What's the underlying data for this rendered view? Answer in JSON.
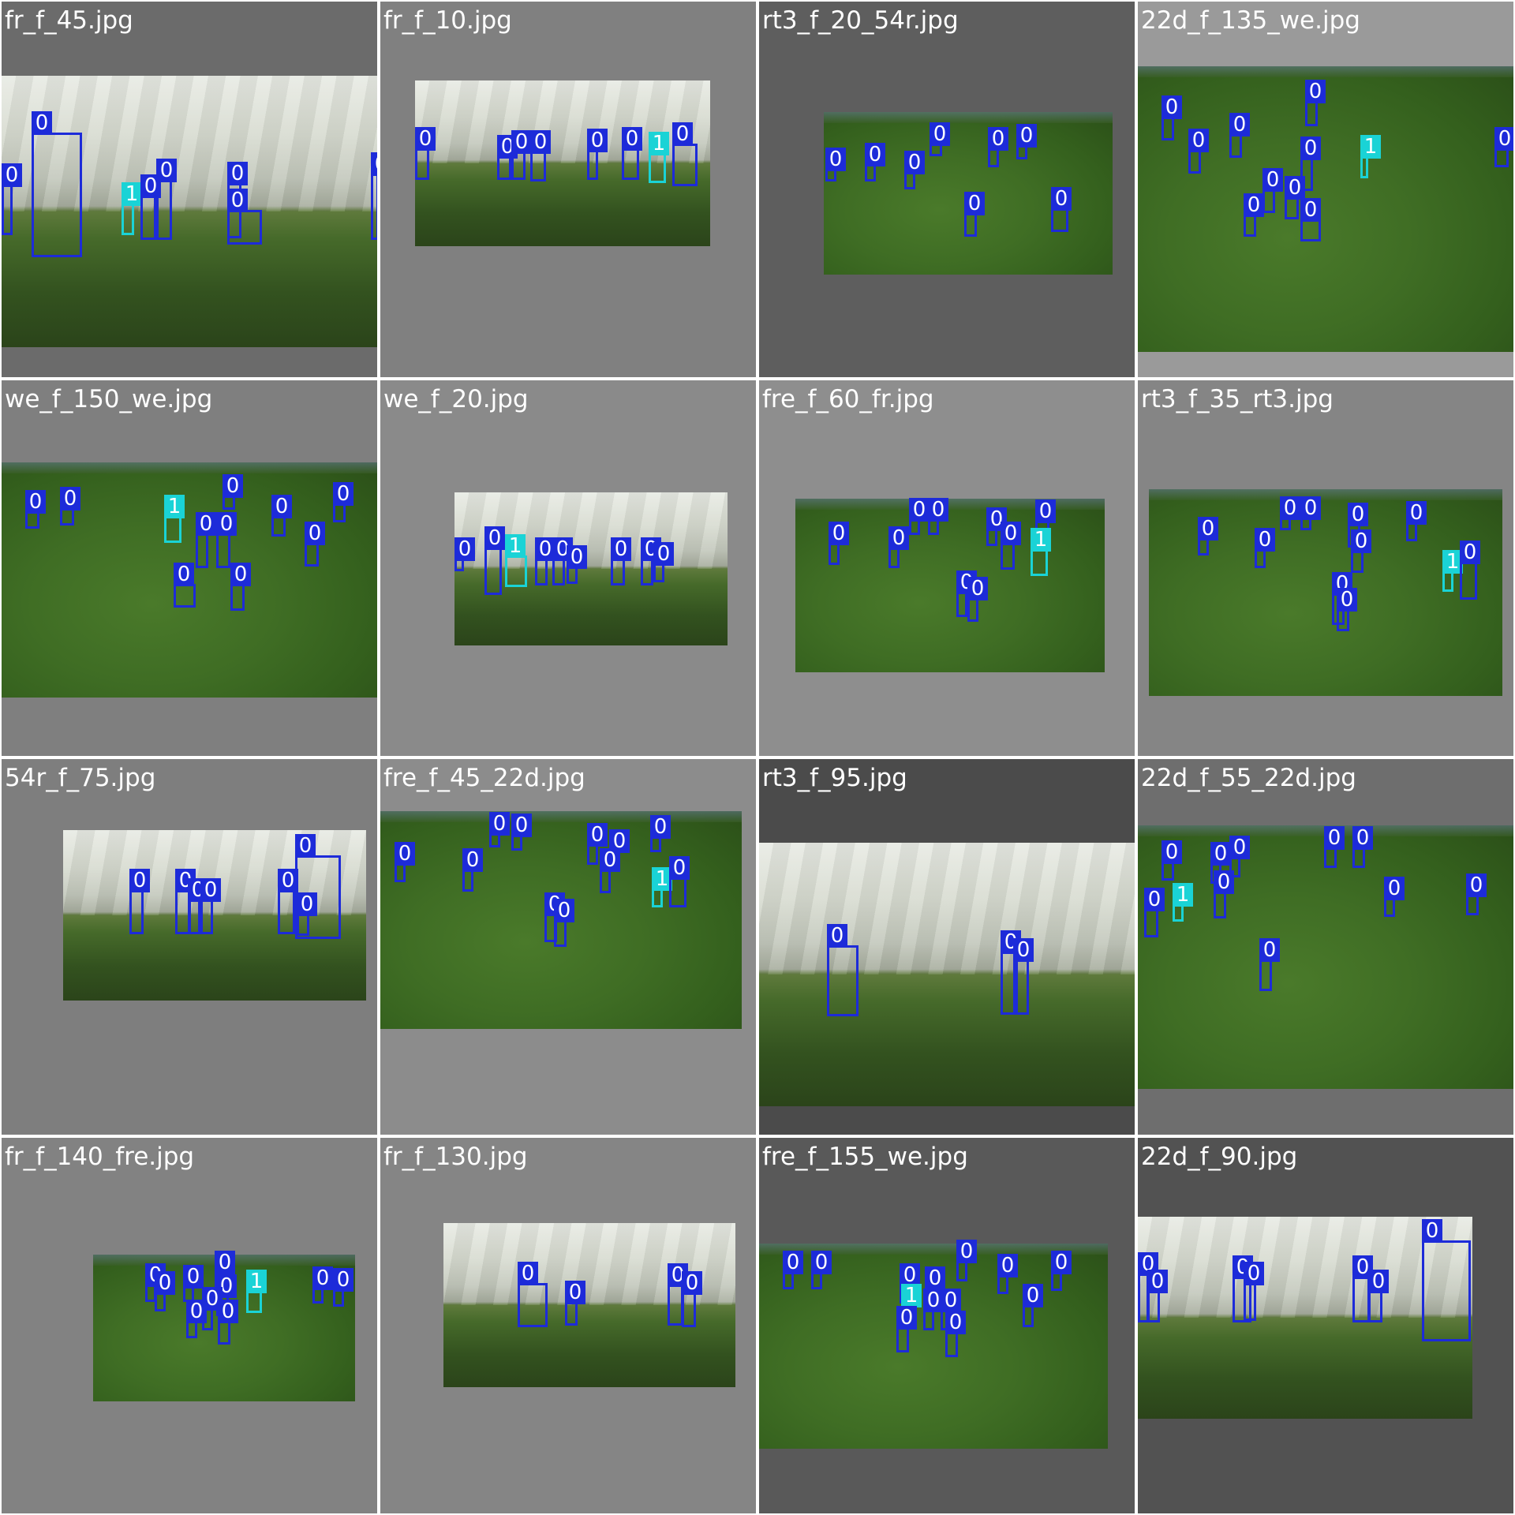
{
  "tiles": [
    {
      "name": "fr_f_45.jpg",
      "bg": "#6b6b6b",
      "scene": "dome"
    },
    {
      "name": "fr_f_10.jpg",
      "bg": "#808080",
      "scene": "dome"
    },
    {
      "name": "rt3_f_20_54r.jpg",
      "bg": "#5e5e5e",
      "scene": "pitch"
    },
    {
      "name": "22d_f_135_we.jpg",
      "bg": "#9a9a9a",
      "scene": "pitch"
    },
    {
      "name": "we_f_150_we.jpg",
      "bg": "#7f7f7f",
      "scene": "pitch"
    },
    {
      "name": "we_f_20.jpg",
      "bg": "#8a8a8a",
      "scene": "dome"
    },
    {
      "name": "fre_f_60_fr.jpg",
      "bg": "#8e8e8e",
      "scene": "pitch"
    },
    {
      "name": "rt3_f_35_rt3.jpg",
      "bg": "#858585",
      "scene": "pitch"
    },
    {
      "name": "54r_f_75.jpg",
      "bg": "#7e7e7e",
      "scene": "dome"
    },
    {
      "name": "fre_f_45_22d.jpg",
      "bg": "#8c8c8c",
      "scene": "pitch"
    },
    {
      "name": "rt3_f_95.jpg",
      "bg": "#4b4b4b",
      "scene": "dome"
    },
    {
      "name": "22d_f_55_22d.jpg",
      "bg": "#6e6e6e",
      "scene": "pitch"
    },
    {
      "name": "fr_f_140_fre.jpg",
      "bg": "#828282",
      "scene": "pitch"
    },
    {
      "name": "fr_f_130.jpg",
      "bg": "#858585",
      "scene": "dome"
    },
    {
      "name": "fre_f_155_we.jpg",
      "bg": "#595959",
      "scene": "pitch"
    },
    {
      "name": "22d_f_90.jpg",
      "bg": "#525252",
      "scene": "dome"
    }
  ],
  "class_labels": {
    "player": "0",
    "ball": "1"
  },
  "colors": {
    "class_0": "#1d2bd9",
    "class_1": "#1ad3d6",
    "separator": "#ffffff"
  }
}
